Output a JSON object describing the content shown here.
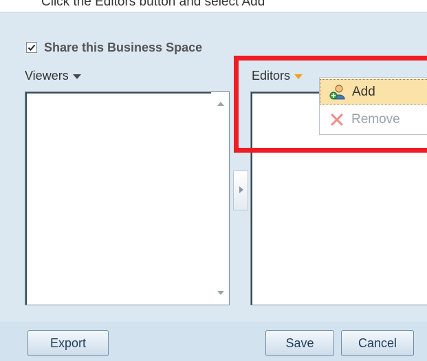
{
  "top": {
    "text": "Click the Editors button and select Add"
  },
  "share": {
    "checked": true,
    "label": "Share this Business Space"
  },
  "viewers": {
    "header": "Viewers"
  },
  "editors": {
    "header": "Editors"
  },
  "menu": {
    "add_label": "Add",
    "remove_label": "Remove"
  },
  "buttons": {
    "export": "Export",
    "save": "Save",
    "cancel": "Cancel"
  },
  "colors": {
    "background": "#dbe8f1",
    "highlight": "#ee1c24",
    "menu_hover": "#fbe2a8",
    "editors_caret": "#f0a020",
    "viewers_caret": "#4a4a4a"
  }
}
